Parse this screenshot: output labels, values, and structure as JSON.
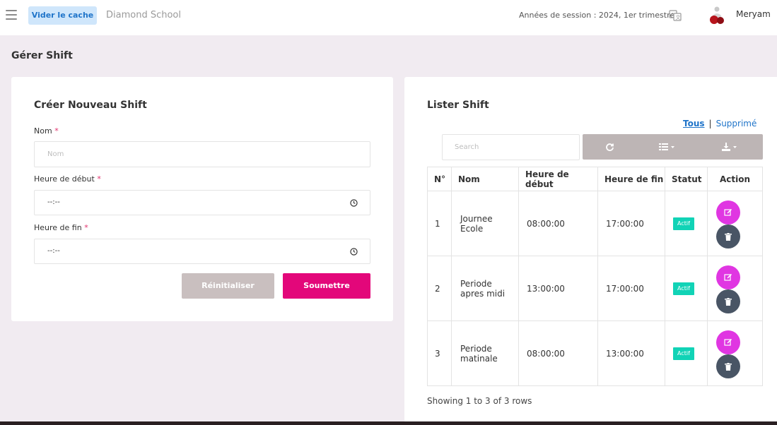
{
  "header": {
    "clear_cache_label": "Vider le cache",
    "school_name": "Diamond School",
    "session_text": "Années de session : 2024, 1er trimestre",
    "user_name": "Meryam"
  },
  "page": {
    "title": "Gérer Shift"
  },
  "create_form": {
    "title": "Créer Nouveau Shift",
    "name_label": "Nom",
    "name_placeholder": "Nom",
    "start_label": "Heure de début",
    "start_value": "--:--",
    "end_label": "Heure de fin",
    "end_value": "--:--",
    "required_mark": "*",
    "reset_label": "Réinitialiser",
    "submit_label": "Soumettre"
  },
  "list": {
    "title": "Lister Shift",
    "filter_all": "Tous",
    "filter_separator": "|",
    "filter_deleted": "Supprimé",
    "search_placeholder": "Search",
    "columns": [
      "N°",
      "Nom",
      "Heure de début",
      "Heure de fin",
      "Statut",
      "Action"
    ],
    "rows": [
      {
        "num": "1",
        "name_line1": "Journee",
        "name_line2": "Ecole",
        "start": "08:00:00",
        "end": "17:00:00",
        "status": "Actif"
      },
      {
        "num": "2",
        "name_line1": "Periode",
        "name_line2": "apres midi",
        "start": "13:00:00",
        "end": "17:00:00",
        "status": "Actif"
      },
      {
        "num": "3",
        "name_line1": "Periode",
        "name_line2": "matinale",
        "start": "08:00:00",
        "end": "13:00:00",
        "status": "Actif"
      }
    ],
    "pagination_text": "Showing 1 to 3 of 3 rows"
  },
  "colors": {
    "submit": "#e3077a",
    "status_badge": "#11d3b6",
    "edit_button": "#e036e2",
    "delete_button": "#495565",
    "link": "#1f74c9"
  },
  "icons": [
    "menu-icon",
    "translate-icon",
    "clock-icon",
    "refresh-icon",
    "list-icon",
    "download-icon",
    "edit-icon",
    "trash-icon"
  ]
}
